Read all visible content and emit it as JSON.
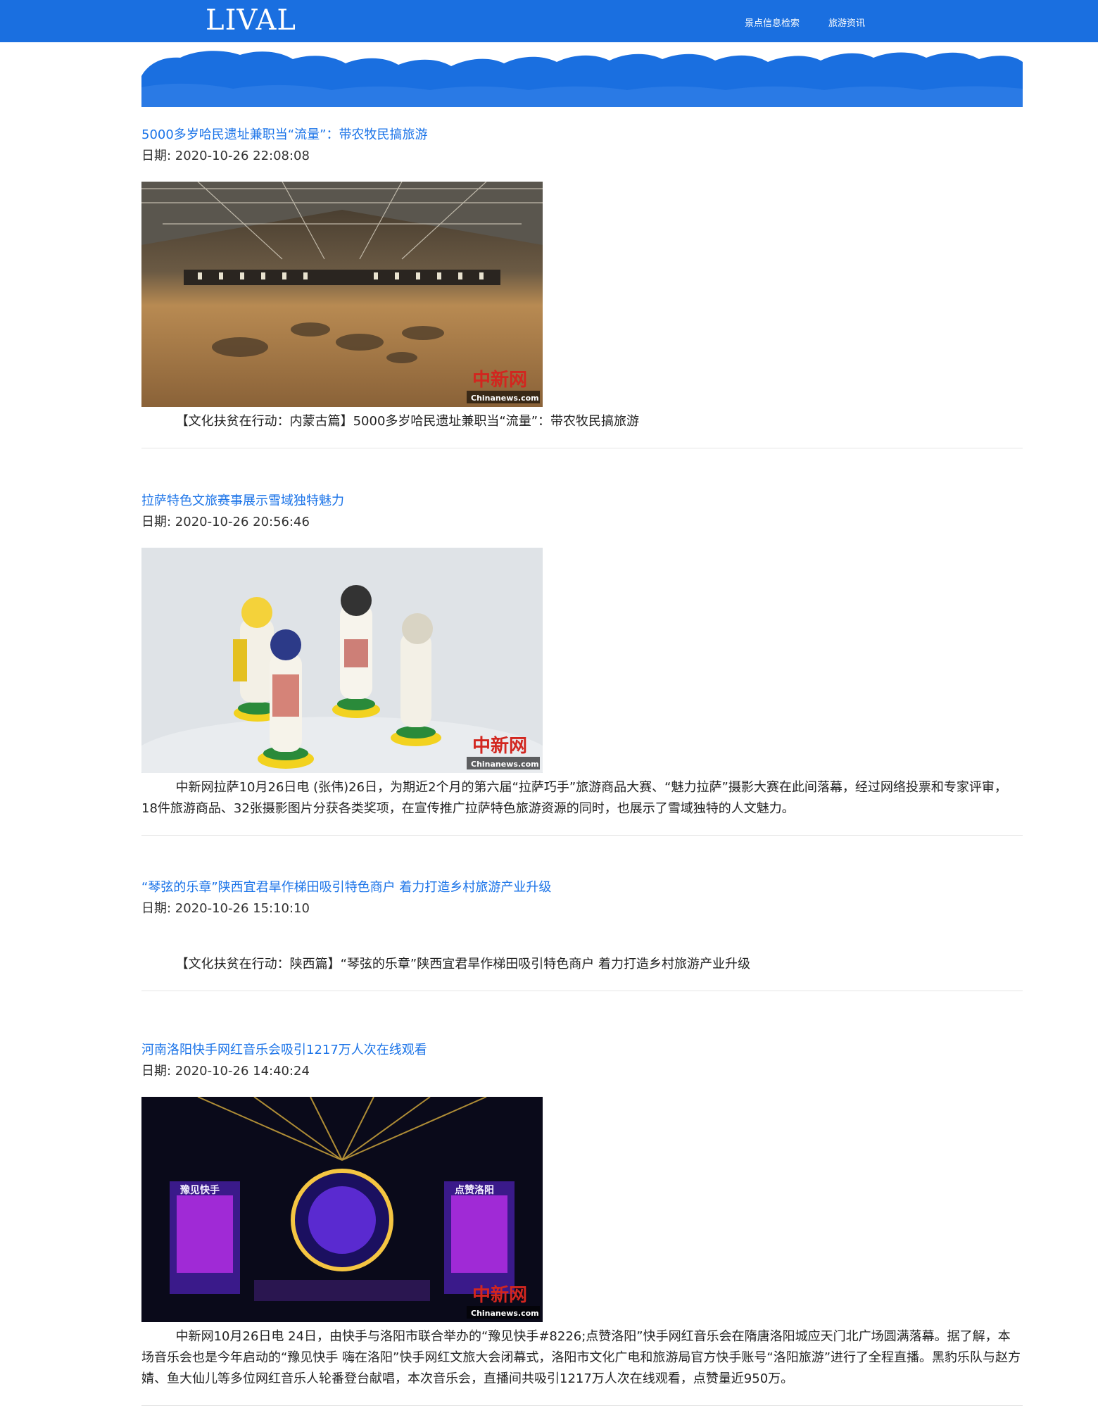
{
  "header": {
    "brand": "LIVAL",
    "nav": [
      "景点信息检索",
      "旅游资讯"
    ]
  },
  "colors": {
    "navbar": "#1a6fe0",
    "banner": "#1a6fe0",
    "link": "#1a73e8"
  },
  "banner": {
    "icon": "cloud-banner"
  },
  "news": [
    {
      "title": "5000多岁哈民遗址兼职当“流量”：带农牧民搞旅游",
      "date": "日期: 2020-10-26 22:08:08",
      "has_image": true,
      "image_watermark": "中新网",
      "image_caption": "Chinanews.com",
      "summary": "【文化扶贫在行动：内蒙古篇】5000多岁哈民遗址兼职当“流量”：带农牧民搞旅游"
    },
    {
      "title": "拉萨特色文旅赛事展示雪域独特魅力",
      "date": "日期: 2020-10-26 20:56:46",
      "has_image": true,
      "image_watermark": "中新网",
      "image_caption": "Chinanews.com",
      "summary": "中新网拉萨10月26日电 (张伟)26日，为期近2个月的第六届“拉萨巧手”旅游商品大赛、“魅力拉萨”摄影大赛在此间落幕，经过网络投票和专家评审，18件旅游商品、32张摄影图片分获各类奖项，在宣传推广拉萨特色旅游资源的同时，也展示了雪域独特的人文魅力。"
    },
    {
      "title": "“琴弦的乐章”陕西宜君旱作梯田吸引特色商户 着力打造乡村旅游产业升级",
      "date": "日期: 2020-10-26 15:10:10",
      "has_image": false,
      "summary": "【文化扶贫在行动：陕西篇】“琴弦的乐章”陕西宜君旱作梯田吸引特色商户 着力打造乡村旅游产业升级"
    },
    {
      "title": "河南洛阳快手网红音乐会吸引1217万人次在线观看",
      "date": "日期: 2020-10-26 14:40:24",
      "has_image": true,
      "image_watermark": "中新网",
      "image_caption": "Chinanews.com",
      "image_screen_left": "豫见快手",
      "image_screen_right": "点赞洛阳",
      "summary": "中新网10月26日电 24日，由快手与洛阳市联合举办的“豫见快手#8226;点赞洛阳”快手网红音乐会在隋唐洛阳城应天门北广场圆满落幕。据了解，本场音乐会也是今年启动的“豫见快手 嗨在洛阳”快手网红文旅大会闭幕式，洛阳市文化广电和旅游局官方快手账号“洛阳旅游”进行了全程直播。黑豹乐队与赵方婧、鱼大仙儿等多位网红音乐人轮番登台献唱，本次音乐会，直播间共吸引1217万人次在线观看，点赞量近950万。"
    }
  ]
}
